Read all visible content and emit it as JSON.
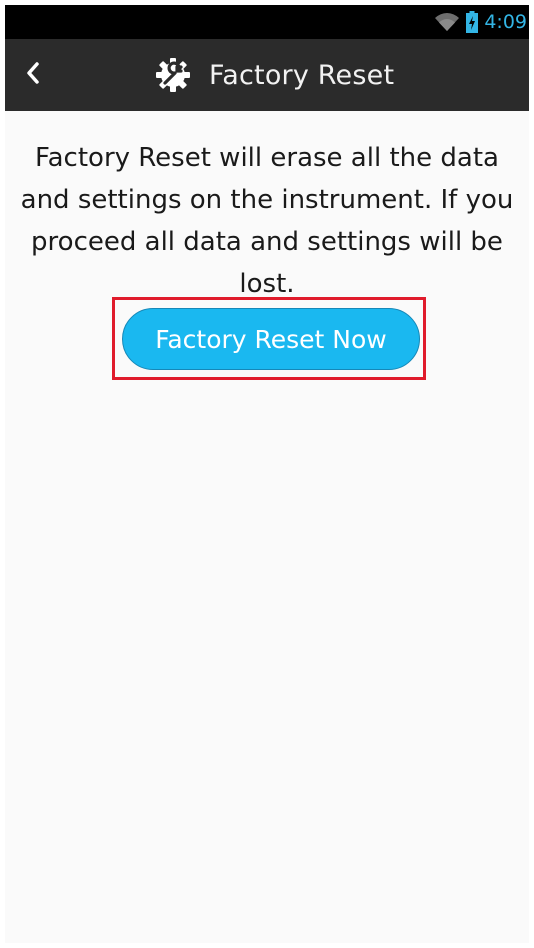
{
  "status_bar": {
    "time": "4:09",
    "wifi_icon": "wifi-icon",
    "battery_icon": "battery-charging-icon",
    "accent_color": "#33b5e5"
  },
  "action_bar": {
    "back_icon": "chevron-left-icon",
    "title_icon": "gear-wrench-icon",
    "title": "Factory Reset",
    "background_color": "#2b2b2b"
  },
  "main": {
    "message": "Factory Reset will erase all the data and settings on the instrument. If you proceed all data and settings will be lost.",
    "reset_button_label": "Factory Reset Now",
    "button_color": "#1ab8f0",
    "highlight_color": "#e01b2b"
  }
}
